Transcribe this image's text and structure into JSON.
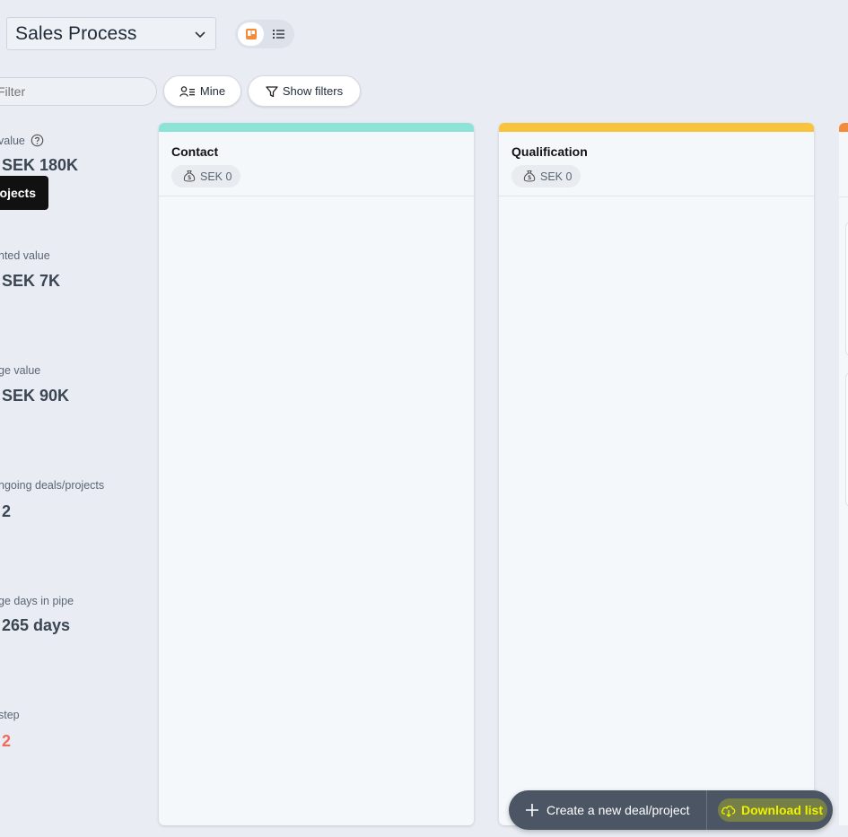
{
  "header": {
    "pipeline_label": "Sales Process"
  },
  "toolbar": {
    "filter_placeholder": "Filter",
    "mine_label": "Mine",
    "show_filters_label": "Show filters"
  },
  "stats": [
    {
      "label": "value",
      "value": "SEK 180K",
      "help_icon": "question-circle-icon"
    },
    {
      "label": "nted value",
      "value": "SEK 7K"
    },
    {
      "label": "ge value",
      "value": "SEK 90K"
    },
    {
      "label": "ngoing deals/projects",
      "value": "2"
    },
    {
      "label": "ge days in pipe",
      "value": "265 days"
    },
    {
      "label": "step",
      "value": "2"
    }
  ],
  "tooltip": "ojects",
  "columns": [
    {
      "title": "Contact",
      "amount": "SEK 0",
      "color": "#8ee3d9"
    },
    {
      "title": "Qualification",
      "amount": "SEK 0",
      "color": "#f9c43d"
    }
  ],
  "partial_column_color": "#f28c3a",
  "actions": {
    "create_label": "Create a new deal/project",
    "download_label": "Download list"
  },
  "colors": {
    "accent": "#f28c3a",
    "danger": "#ef6b5b",
    "action_bar": "#4b5563"
  }
}
